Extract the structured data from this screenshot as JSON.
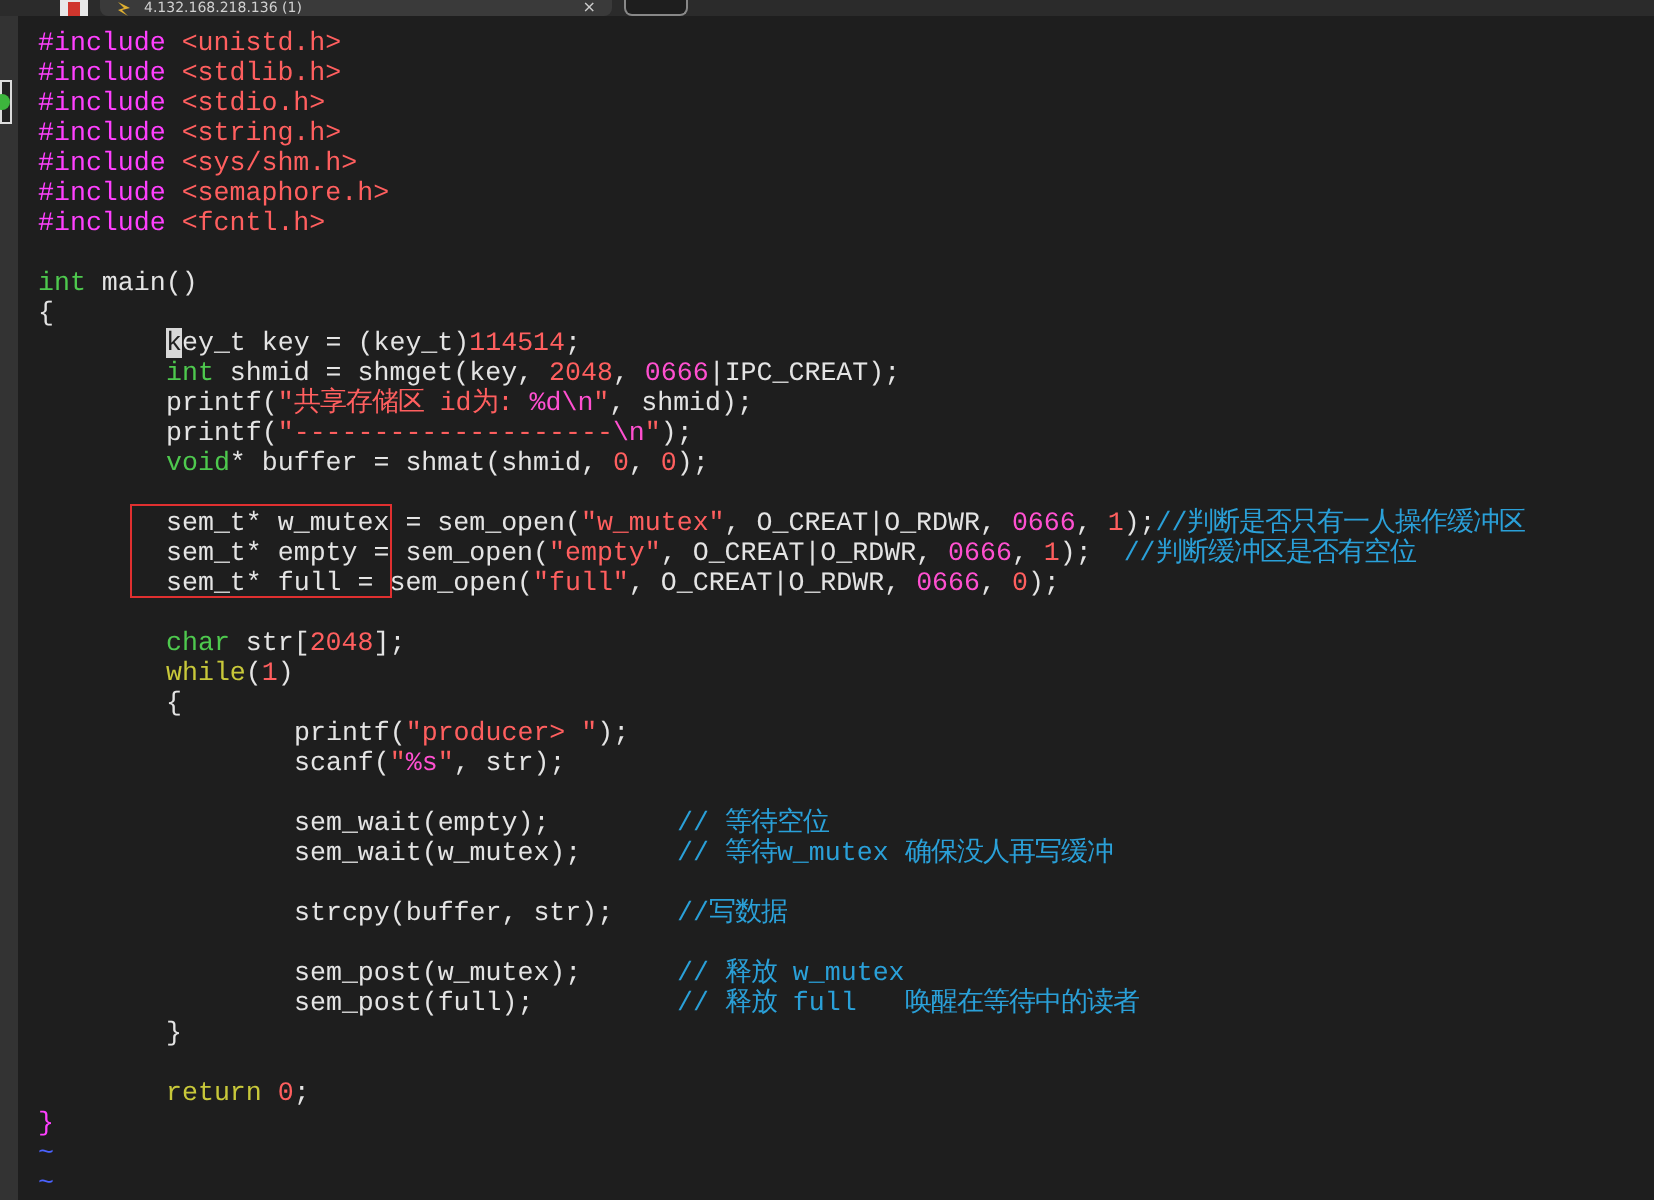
{
  "tab": {
    "title": "4.132.168.218.136 (1)",
    "close": "×"
  },
  "lines": [
    {
      "kind": "code",
      "tokens": [
        {
          "kind": "preproc",
          "text": "#include"
        },
        {
          "kind": "string",
          "text": " <unistd.h>"
        }
      ]
    },
    {
      "kind": "code",
      "tokens": [
        {
          "kind": "preproc",
          "text": "#include"
        },
        {
          "kind": "string",
          "text": " <stdlib.h>"
        }
      ]
    },
    {
      "kind": "code",
      "tokens": [
        {
          "kind": "preproc",
          "text": "#include"
        },
        {
          "kind": "string",
          "text": " <stdio.h>"
        }
      ]
    },
    {
      "kind": "code",
      "tokens": [
        {
          "kind": "preproc",
          "text": "#include"
        },
        {
          "kind": "string",
          "text": " <string.h>"
        }
      ]
    },
    {
      "kind": "code",
      "tokens": [
        {
          "kind": "preproc",
          "text": "#include"
        },
        {
          "kind": "string",
          "text": " <sys/shm.h>"
        }
      ]
    },
    {
      "kind": "code",
      "tokens": [
        {
          "kind": "preproc",
          "text": "#include"
        },
        {
          "kind": "string",
          "text": " <semaphore.h>"
        }
      ]
    },
    {
      "kind": "code",
      "tokens": [
        {
          "kind": "preproc",
          "text": "#include"
        },
        {
          "kind": "string",
          "text": " <fcntl.h>"
        }
      ]
    },
    {
      "kind": "blank"
    },
    {
      "kind": "code",
      "tokens": [
        {
          "kind": "type",
          "text": "int"
        },
        {
          "kind": "plain",
          "text": " main()"
        }
      ]
    },
    {
      "kind": "code",
      "tokens": [
        {
          "kind": "plain",
          "text": "{"
        }
      ],
      "children": [
        {
          "kind": "code",
          "tokens": [
            {
              "kind": "cursor",
              "text": "k"
            },
            {
              "kind": "plain",
              "text": "ey_t key = (key_t)"
            },
            {
              "kind": "number",
              "text": "114514"
            },
            {
              "kind": "plain",
              "text": ";"
            }
          ]
        },
        {
          "kind": "code",
          "tokens": [
            {
              "kind": "type",
              "text": "int"
            },
            {
              "kind": "plain",
              "text": " shmid = shmget(key, "
            },
            {
              "kind": "number",
              "text": "2048"
            },
            {
              "kind": "plain",
              "text": ", "
            },
            {
              "kind": "special",
              "text": "0666"
            },
            {
              "kind": "plain",
              "text": "|IPC_CREAT);"
            }
          ]
        },
        {
          "kind": "code",
          "tokens": [
            {
              "kind": "plain",
              "text": "printf("
            },
            {
              "kind": "string",
              "text": "\"共享存储区 id为: "
            },
            {
              "kind": "special",
              "text": "%d\\n"
            },
            {
              "kind": "string",
              "text": "\""
            },
            {
              "kind": "plain",
              "text": ", shmid);"
            }
          ]
        },
        {
          "kind": "code",
          "tokens": [
            {
              "kind": "plain",
              "text": "printf("
            },
            {
              "kind": "string",
              "text": "\"--------------------"
            },
            {
              "kind": "special",
              "text": "\\n"
            },
            {
              "kind": "string",
              "text": "\""
            },
            {
              "kind": "plain",
              "text": ");"
            }
          ]
        },
        {
          "kind": "code",
          "tokens": [
            {
              "kind": "type",
              "text": "void"
            },
            {
              "kind": "plain",
              "text": "* buffer = shmat(shmid, "
            },
            {
              "kind": "number",
              "text": "0"
            },
            {
              "kind": "plain",
              "text": ", "
            },
            {
              "kind": "number",
              "text": "0"
            },
            {
              "kind": "plain",
              "text": ");"
            }
          ]
        },
        {
          "kind": "blank"
        },
        {
          "kind": "code",
          "tokens": [
            {
              "kind": "plain",
              "text": "sem_t* w_mutex = sem_open("
            },
            {
              "kind": "string",
              "text": "\"w_mutex\""
            },
            {
              "kind": "plain",
              "text": ", O_CREAT|O_RDWR, "
            },
            {
              "kind": "special",
              "text": "0666"
            },
            {
              "kind": "plain",
              "text": ", "
            },
            {
              "kind": "number",
              "text": "1"
            },
            {
              "kind": "plain",
              "text": ");"
            },
            {
              "kind": "comment",
              "text": "//判断是否只有一人操作缓冲区"
            }
          ]
        },
        {
          "kind": "code",
          "tokens": [
            {
              "kind": "plain",
              "text": "sem_t* empty = sem_open("
            },
            {
              "kind": "string",
              "text": "\"empty\""
            },
            {
              "kind": "plain",
              "text": ", O_CREAT|O_RDWR, "
            },
            {
              "kind": "special",
              "text": "0666"
            },
            {
              "kind": "plain",
              "text": ", "
            },
            {
              "kind": "number",
              "text": "1"
            },
            {
              "kind": "plain",
              "text": ");  "
            },
            {
              "kind": "comment",
              "text": "//判断缓冲区是否有空位"
            }
          ]
        },
        {
          "kind": "code",
          "tokens": [
            {
              "kind": "plain",
              "text": "sem_t* full = sem_open("
            },
            {
              "kind": "string",
              "text": "\"full\""
            },
            {
              "kind": "plain",
              "text": ", O_CREAT|O_RDWR, "
            },
            {
              "kind": "special",
              "text": "0666"
            },
            {
              "kind": "plain",
              "text": ", "
            },
            {
              "kind": "number",
              "text": "0"
            },
            {
              "kind": "plain",
              "text": ");"
            }
          ]
        },
        {
          "kind": "blank"
        },
        {
          "kind": "code",
          "tokens": [
            {
              "kind": "type",
              "text": "char"
            },
            {
              "kind": "plain",
              "text": " str["
            },
            {
              "kind": "number",
              "text": "2048"
            },
            {
              "kind": "plain",
              "text": "];"
            }
          ]
        },
        {
          "kind": "code",
          "tokens": [
            {
              "kind": "statement",
              "text": "while"
            },
            {
              "kind": "plain",
              "text": "("
            },
            {
              "kind": "number",
              "text": "1"
            },
            {
              "kind": "plain",
              "text": ")"
            }
          ]
        },
        {
          "kind": "code",
          "tokens": [
            {
              "kind": "plain",
              "text": "{"
            }
          ],
          "children": [
            {
              "kind": "code",
              "tokens": [
                {
                  "kind": "plain",
                  "text": "printf("
                },
                {
                  "kind": "string",
                  "text": "\"producer> \""
                },
                {
                  "kind": "plain",
                  "text": ");"
                }
              ]
            },
            {
              "kind": "code",
              "tokens": [
                {
                  "kind": "plain",
                  "text": "scanf("
                },
                {
                  "kind": "string",
                  "text": "\""
                },
                {
                  "kind": "special",
                  "text": "%s"
                },
                {
                  "kind": "string",
                  "text": "\""
                },
                {
                  "kind": "plain",
                  "text": ", str);"
                }
              ]
            },
            {
              "kind": "blank"
            },
            {
              "kind": "code",
              "tokens": [
                {
                  "kind": "plain",
                  "text": "sem_wait(empty);        "
                },
                {
                  "kind": "comment",
                  "text": "// 等待空位"
                }
              ]
            },
            {
              "kind": "code",
              "tokens": [
                {
                  "kind": "plain",
                  "text": "sem_wait(w_mutex);      "
                },
                {
                  "kind": "comment",
                  "text": "// 等待w_mutex 确保没人再写缓冲"
                }
              ]
            },
            {
              "kind": "blank"
            },
            {
              "kind": "code",
              "tokens": [
                {
                  "kind": "plain",
                  "text": "strcpy(buffer, str);    "
                },
                {
                  "kind": "comment",
                  "text": "//写数据"
                }
              ]
            },
            {
              "kind": "blank"
            },
            {
              "kind": "code",
              "tokens": [
                {
                  "kind": "plain",
                  "text": "sem_post(w_mutex);      "
                },
                {
                  "kind": "comment",
                  "text": "// 释放 w_mutex"
                }
              ]
            },
            {
              "kind": "code",
              "tokens": [
                {
                  "kind": "plain",
                  "text": "sem_post(full);         "
                },
                {
                  "kind": "comment",
                  "text": "// 释放 full   唤醒在等待中的读者"
                }
              ]
            }
          ]
        },
        {
          "kind": "code",
          "tokens": [
            {
              "kind": "plain",
              "text": "}"
            }
          ]
        },
        {
          "kind": "blank"
        },
        {
          "kind": "code",
          "tokens": [
            {
              "kind": "statement",
              "text": "return"
            },
            {
              "kind": "number",
              "text": " 0"
            },
            {
              "kind": "plain",
              "text": ";"
            }
          ]
        }
      ]
    },
    {
      "kind": "code",
      "tokens": [
        {
          "kind": "match",
          "text": "}"
        }
      ]
    },
    {
      "kind": "code",
      "tokens": [
        {
          "kind": "tilde",
          "text": "~"
        }
      ]
    },
    {
      "kind": "code",
      "tokens": [
        {
          "kind": "tilde",
          "text": "~"
        }
      ]
    }
  ]
}
